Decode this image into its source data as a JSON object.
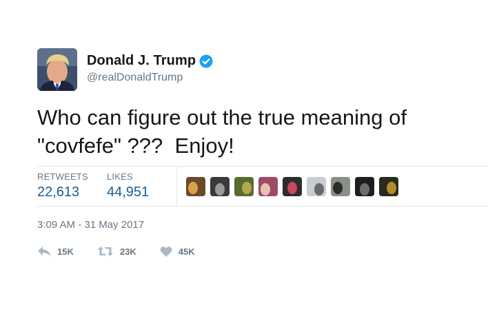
{
  "user": {
    "display_name": "Donald J. Trump",
    "handle": "@realDonaldTrump",
    "verified_icon": "verified-badge-icon",
    "avatar_icon": "profile-photo"
  },
  "tweet": {
    "text": "Who can figure out the true meaning of\n\"covfefe\" ???  Enjoy!"
  },
  "stats": {
    "retweets_label": "RETWEETS",
    "retweets_value": "22,613",
    "likes_label": "LIKES",
    "likes_value": "44,951"
  },
  "likers": [
    {
      "name": "liker-avatar-1",
      "colors": [
        "#6b4a2a",
        "#d9a347"
      ]
    },
    {
      "name": "liker-avatar-2",
      "colors": [
        "#3a3a3a",
        "#9a9a9a"
      ]
    },
    {
      "name": "liker-avatar-3",
      "colors": [
        "#5a6b2e",
        "#b3a64f"
      ]
    },
    {
      "name": "liker-avatar-4",
      "colors": [
        "#a04a6a",
        "#e7c1b0"
      ]
    },
    {
      "name": "liker-avatar-5",
      "colors": [
        "#2c2c2c",
        "#c9485a"
      ]
    },
    {
      "name": "liker-avatar-6",
      "colors": [
        "#c9cdd2",
        "#6a6a6a"
      ]
    },
    {
      "name": "liker-avatar-7",
      "colors": [
        "#8a8f8a",
        "#2d2d2d"
      ]
    },
    {
      "name": "liker-avatar-8",
      "colors": [
        "#1e1e1e",
        "#6d6d6d"
      ]
    },
    {
      "name": "liker-avatar-9",
      "colors": [
        "#2a2a1e",
        "#b38a2a"
      ]
    }
  ],
  "timestamp": "3:09 AM - 31 May 2017",
  "actions": {
    "reply_count": "15K",
    "retweet_count": "23K",
    "like_count": "45K"
  },
  "colors": {
    "verified": "#1da1f2",
    "stat_value": "#1b5c8f",
    "secondary_text": "#657786",
    "action_icon": "#aab8c2"
  }
}
